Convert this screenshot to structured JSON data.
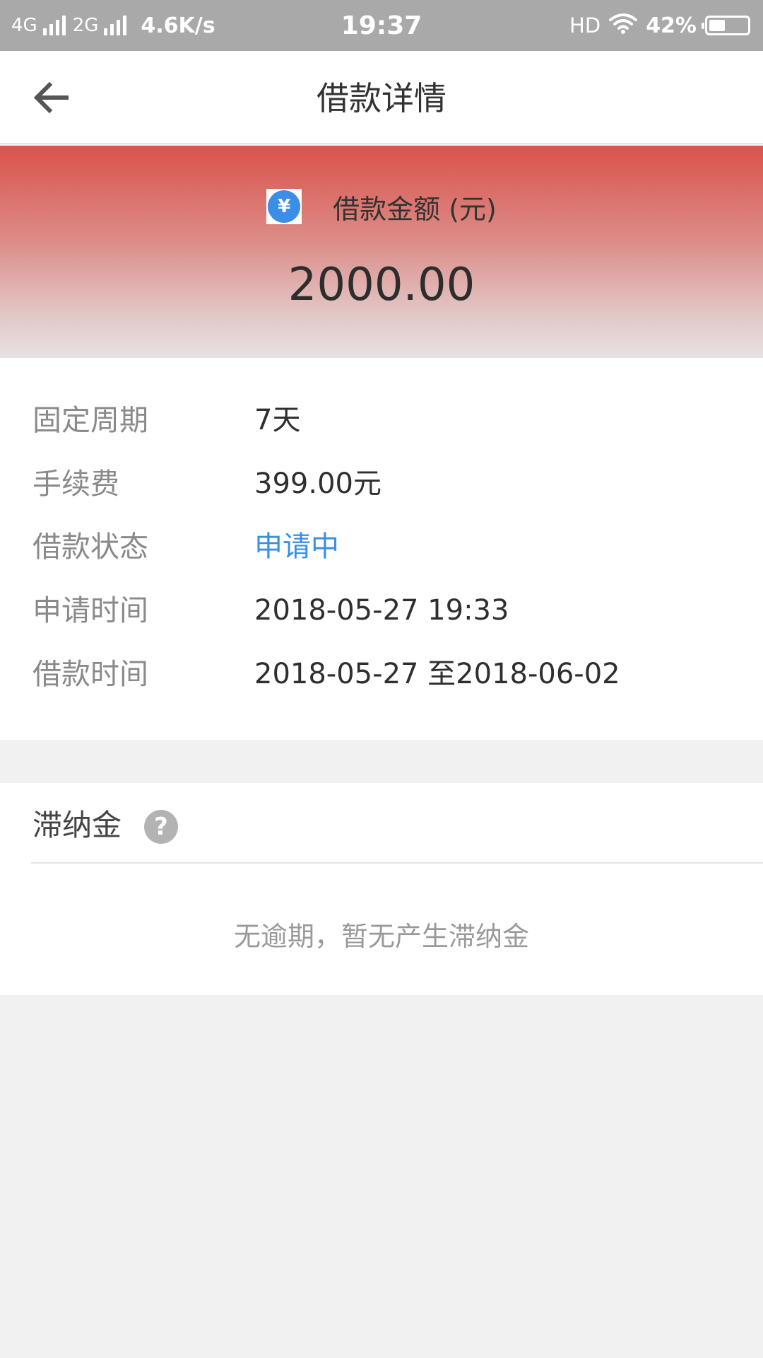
{
  "status_bar": {
    "network1": "4G",
    "network2": "2G",
    "speed": "4.6K/s",
    "time": "19:37",
    "hd": "HD",
    "battery_text": "42%",
    "battery_level": 0.42
  },
  "header": {
    "title": "借款详情",
    "back_icon": "arrow-left-icon"
  },
  "amount": {
    "icon": "yen-icon",
    "icon_glyph": "¥",
    "label": "借款金额 (元)",
    "value": "2000.00"
  },
  "details": [
    {
      "label": "固定周期",
      "value": "7天"
    },
    {
      "label": "手续费",
      "value": "399.00元"
    },
    {
      "label": "借款状态",
      "value": "申请中"
    },
    {
      "label": "申请时间",
      "value": "2018-05-27 19:33"
    },
    {
      "label": "借款时间",
      "value": "2018-05-27 至2018-06-02"
    }
  ],
  "late_fee": {
    "title": "滞纳金",
    "help_icon": "question-icon",
    "help_glyph": "?",
    "message": "无逾期，暂无产生滞纳金"
  },
  "colors": {
    "status_bar": "#a9a9a9",
    "banner_top": "#d9534b",
    "status_blue": "#3a8fe4",
    "yen_blue": "#3b8ee8"
  }
}
